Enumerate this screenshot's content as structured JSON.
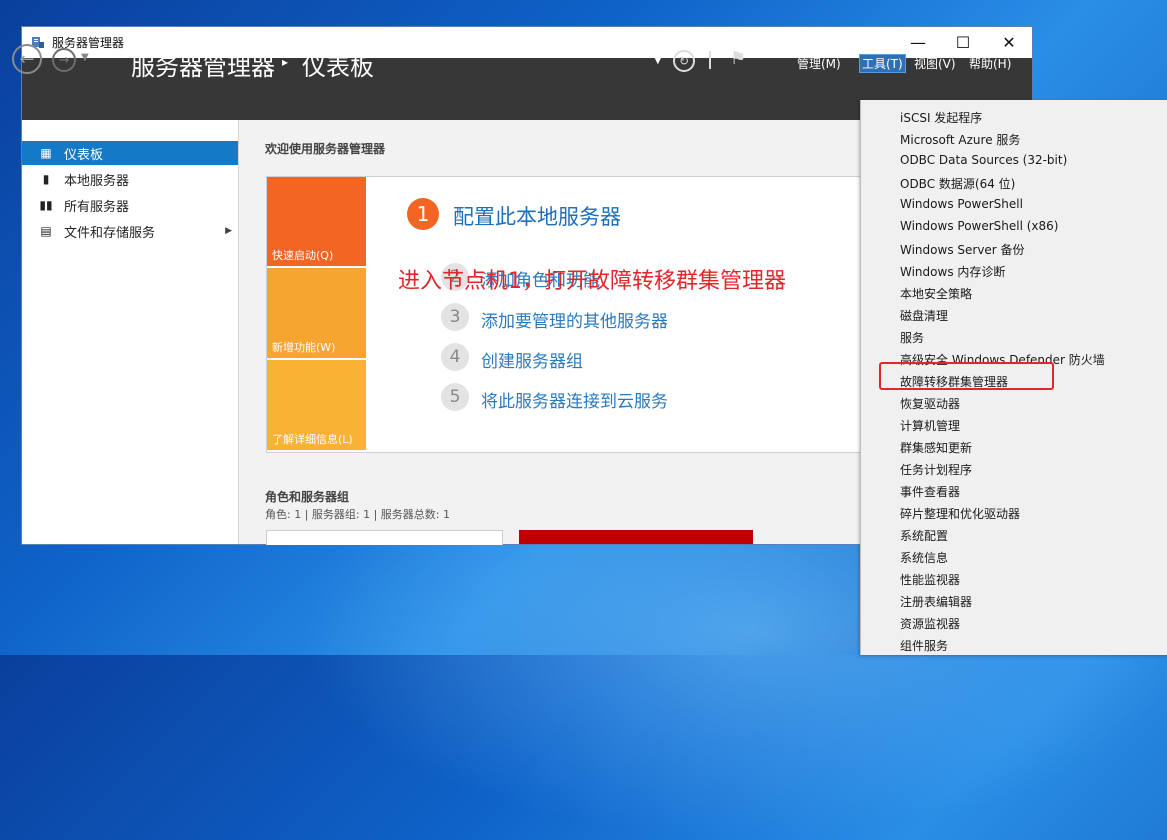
{
  "window": {
    "title": "服务器管理器",
    "controls": {
      "minimize": "—",
      "maximize": "☐",
      "close": "✕"
    }
  },
  "header": {
    "app_name": "服务器管理器",
    "separator": "▸",
    "page_title": "仪表板",
    "menus": [
      "管理(M)",
      "工具(T)",
      "视图(V)",
      "帮助(H)"
    ],
    "active_menu": "工具(T)"
  },
  "sidebar": {
    "items": [
      {
        "label": "仪表板",
        "icon": "dashboard-icon",
        "active": true
      },
      {
        "label": "本地服务器",
        "icon": "server-icon"
      },
      {
        "label": "所有服务器",
        "icon": "servers-icon"
      },
      {
        "label": "文件和存储服务",
        "icon": "storage-icon",
        "has_arrow": true
      }
    ]
  },
  "main": {
    "welcome": "欢迎使用服务器管理器",
    "tiles": [
      {
        "label": "快速启动(Q)",
        "color": "#f26522"
      },
      {
        "label": "新增功能(W)",
        "color": "#f7a531"
      },
      {
        "label": "了解详细信息(L)",
        "color": "#f9b234"
      }
    ],
    "steps": [
      {
        "num": "1",
        "label": "配置此本地服务器"
      },
      {
        "num": "2",
        "label": "添加角色和功能"
      },
      {
        "num": "3",
        "label": "添加要管理的其他服务器"
      },
      {
        "num": "4",
        "label": "创建服务器组"
      },
      {
        "num": "5",
        "label": "将此服务器连接到云服务"
      }
    ],
    "roles_title": "角色和服务器组",
    "roles_sub": "角色: 1 | 服务器组: 1 | 服务器总数: 1"
  },
  "annotation": "进入节点机1，打开故障转移群集管理器",
  "tools_menu": {
    "items": [
      "iSCSI 发起程序",
      "Microsoft Azure 服务",
      "ODBC Data Sources (32-bit)",
      "ODBC 数据源(64 位)",
      "Windows PowerShell",
      "Windows PowerShell (x86)",
      "Windows Server 备份",
      "Windows 内存诊断",
      "本地安全策略",
      "磁盘清理",
      "服务",
      "高级安全 Windows Defender 防火墙",
      "故障转移群集管理器",
      "恢复驱动器",
      "计算机管理",
      "群集感知更新",
      "任务计划程序",
      "事件查看器",
      "碎片整理和优化驱动器",
      "系统配置",
      "系统信息",
      "性能监视器",
      "注册表编辑器",
      "资源监视器",
      "组件服务"
    ],
    "highlighted": "故障转移群集管理器"
  },
  "colors": {
    "accent": "#1479c6",
    "header_bg": "#373737",
    "annotation": "#e3262b",
    "step1": "#f26522"
  }
}
